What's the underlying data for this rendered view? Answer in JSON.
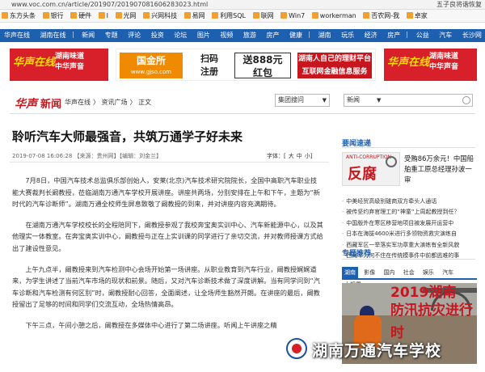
{
  "browser": {
    "url": "www.voc.com.cn/article/201907/201907081606283023.html",
    "right_text": "五子良将谐恢复"
  },
  "favorites": [
    "东方头条",
    "银行",
    "硬件",
    "I",
    "光网",
    "兴网科技",
    "易网",
    "利用SQL",
    "联网",
    "Win7",
    "workerman",
    "否农网-我",
    "卓家"
  ],
  "nav": [
    "华声在线",
    "湖南在线",
    "新闻",
    "专题",
    "评论",
    "投资",
    "论坛",
    "图片",
    "视频",
    "旅游",
    "房产",
    "健康",
    "湖南",
    "玩乐",
    "经济",
    "房产",
    "公益",
    "汽车",
    "长沙网"
  ],
  "banners": {
    "left_brand": "华声在线",
    "left_slogan1": "湖南味道",
    "left_slogan2": "中华声音",
    "gjs_name": "国金所",
    "gjs_url": "www.gjso.com",
    "gjs_tag1": "扫码",
    "gjs_tag2": "注册",
    "gjs_bonus1": "送888元",
    "gjs_bonus2": "红包",
    "gjs_ad1": "湖南人自己的理财平台",
    "gjs_ad2": "互联网金融信息服务",
    "right_brand": "华声在线",
    "right_slogan1": "湖南味道",
    "right_slogan2": "中华声音"
  },
  "header": {
    "logo_left": "华声",
    "logo_right": "新闻",
    "breadcrumb": [
      "华声在线",
      "资讯广场",
      "正文"
    ],
    "search1": "集团搜问",
    "search2": "新闻"
  },
  "article": {
    "title": "聆听汽车大师最强音，共筑万通学子好未来",
    "meta": "2019-07-08 16:06:28 【来源：贵州网】【编辑：刘金兰】",
    "fontsize_label": "字体：",
    "fontsize_options": [
      "大",
      "中",
      "小"
    ],
    "paragraphs": [
      "7月8日，中国汽车技术总监俱乐部创始人，安莱(北京)汽车技术研究院院长，全国中高职汽车职业技能大赛裁判长阚教授，莅临湖南万通汽车学校开展讲座。讲座共两场，分别安排在上午和下午，主题为“新时代的汽车诊断师”。湖南万通全校师生屏息致敬了阚教授的到来，并对讲座内容充满期待。",
      "在湖南万通汽车学校校长的全程陪同下，阚教授参观了我校奔宝奥实训中心、汽车新能源中心，以及其他理实一体教室。在奔宝奥实训中心，阚教授与正在上实训课的同学进行了亲切交流，并对教师授课方式给出了建设性意见。",
      "上午九点半，阚教授来到汽车检测中心会场开始第一场讲座。从职业教育到汽车行业，阚教授娓娓道来，为学生讲述了当前汽车市场的现状和前景。随后，又对汽车诊断技术做了深度讲解。当有同学问到“汽车诊断和汽车检测有何区别”时，阚教授耐心回答，全面阐述，让全场师生豁然开朗。在讲座的最后，阚教授留出了足够的时间和同学们交流互动，全场热情高昂。",
      "下午三点，午间小憩之后，阚教授在多媒体中心进行了第二场讲座。听闻上午讲座之精"
    ]
  },
  "sidebar": {
    "title1": "要闻速递",
    "corr_small": "ANTI-CORRUPTION",
    "corr_big": "反腐",
    "featured": "受贿86万余元！中国船舶重工原总经理孙波一审",
    "news": [
      "中美经贸高级别磋商双方牵头人通话",
      "被传坚约弃官理工的“神童”上周起教授到任？",
      "中国版外在寒区移营地项目被发展开运营中",
      "日本在海拔4600米进行多领物资救灾演练自",
      "西藏军区一举落实军功章重大演练有全新风貌",
      "西藏军为何不住在传统模事件中前都逃难的事"
    ],
    "title2": "专题推荐",
    "tabs": [
      "湖南",
      "影像",
      "国内",
      "社会",
      "娱乐",
      "汽车",
      "大视界"
    ],
    "photo_year": "2019湖南",
    "photo_text": "防汛抗灾进行时",
    "watermark": "湖南万通汽车学校"
  },
  "colors": {
    "brand_red": "#c8161e",
    "nav_blue": "#1e60b0"
  }
}
